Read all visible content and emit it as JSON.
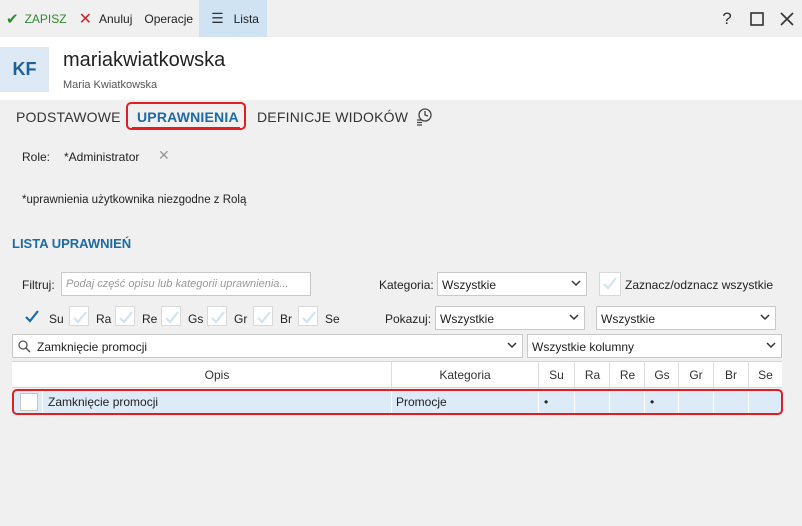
{
  "toolbar": {
    "save_label": "ZAPISZ",
    "cancel_label": "Anuluj",
    "operations_label": "Operacje",
    "list_label": "Lista",
    "help_label": "?"
  },
  "user": {
    "initials": "KF",
    "username": "mariakwiatkowska",
    "full_name": "Maria Kwiatkowska"
  },
  "tabs": [
    {
      "label": "PODSTAWOWE"
    },
    {
      "label": "UPRAWNIENIA"
    },
    {
      "label": "DEFINICJE WIDOKÓW"
    }
  ],
  "roles": {
    "label": "Role:",
    "value": "*Administrator"
  },
  "note": "*uprawnienia użytkownika niezgodne z Rolą",
  "section_title": "LISTA UPRAWNIEŃ",
  "filters": {
    "filter_label": "Filtruj:",
    "filter_placeholder": "Podaj część opisu lub kategorii uprawnienia...",
    "category_label": "Kategoria:",
    "category_value": "Wszystkie",
    "toggle_all_label": "Zaznacz/odznacz wszystkie",
    "show_label": "Pokazuj:",
    "show_value": "Wszystkie",
    "show_value2": "Wszystkie",
    "search_value": "Zamknięcie promocji",
    "columns_value": "Wszystkie kolumny"
  },
  "perm_flags": [
    {
      "label": "Su",
      "checked": true
    },
    {
      "label": "Ra",
      "checked": false
    },
    {
      "label": "Re",
      "checked": false
    },
    {
      "label": "Gs",
      "checked": false
    },
    {
      "label": "Gr",
      "checked": false
    },
    {
      "label": "Br",
      "checked": false
    },
    {
      "label": "Se",
      "checked": false
    }
  ],
  "grid": {
    "columns": [
      "Opis",
      "Kategoria",
      "Su",
      "Ra",
      "Re",
      "Gs",
      "Gr",
      "Br",
      "Se"
    ],
    "rows": [
      {
        "opis": "Zamknięcie promocji",
        "kategoria": "Promocje",
        "su": "•",
        "ra": "",
        "re": "",
        "gs": "•",
        "gr": "",
        "br": "",
        "se": ""
      }
    ]
  },
  "colors": {
    "accent": "#1c6aa6",
    "highlight": "#e02020",
    "save": "#2e8b2e",
    "cancel": "#d32626"
  }
}
